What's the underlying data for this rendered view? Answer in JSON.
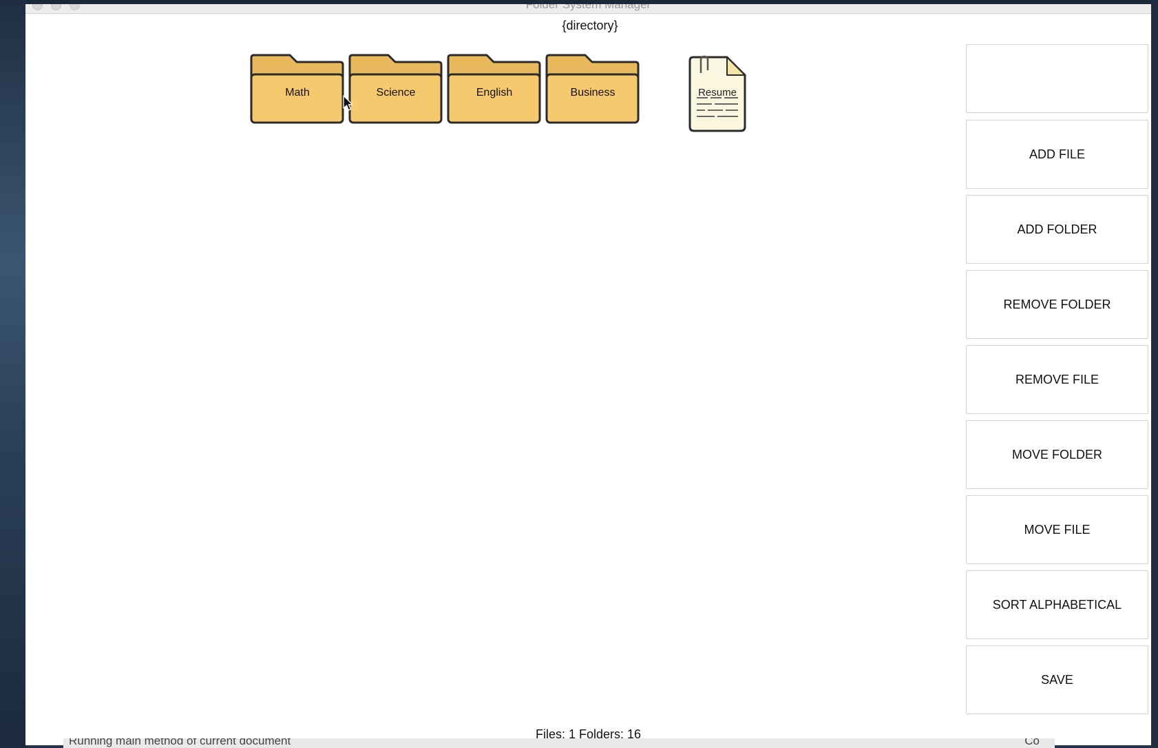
{
  "window": {
    "title": "Folder System Manager"
  },
  "directory": {
    "label": "{directory}"
  },
  "folders": [
    {
      "label": "Math"
    },
    {
      "label": "Science"
    },
    {
      "label": "English"
    },
    {
      "label": "Business"
    }
  ],
  "files": [
    {
      "label": "Resume",
      "icon": "document-icon"
    }
  ],
  "sidebar": {
    "input_value": "",
    "buttons": [
      {
        "label": "ADD FILE"
      },
      {
        "label": "ADD FOLDER"
      },
      {
        "label": "REMOVE FOLDER"
      },
      {
        "label": "REMOVE FILE"
      },
      {
        "label": "MOVE FOLDER"
      },
      {
        "label": "MOVE FILE"
      },
      {
        "label": "SORT ALPHABETICAL"
      },
      {
        "label": "SAVE"
      }
    ]
  },
  "status": {
    "text": "Files: 1 Folders: 16"
  },
  "background_terminal": {
    "left_text": "Running main method of current document",
    "right_text": "Co"
  },
  "colors": {
    "folder_fill": "#f7c96e",
    "folder_tab": "#e9b95e",
    "folder_outline": "#2b2b2b",
    "document_fill": "#fbf6e0"
  }
}
